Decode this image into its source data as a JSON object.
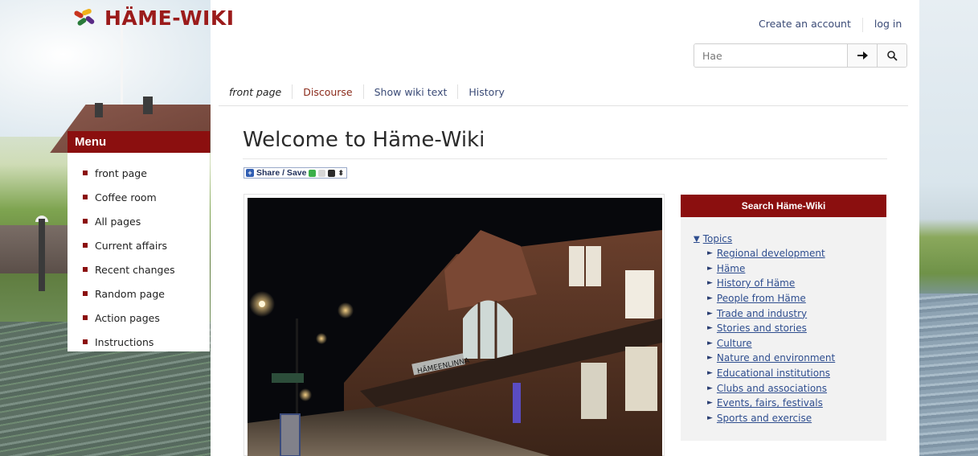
{
  "logo": {
    "text": "HÄME-WIKI"
  },
  "menu": {
    "title": "Menu",
    "items": [
      {
        "label": "front page"
      },
      {
        "label": "Coffee room"
      },
      {
        "label": "All pages"
      },
      {
        "label": "Current affairs"
      },
      {
        "label": "Recent changes"
      },
      {
        "label": "Random page"
      },
      {
        "label": "Action pages"
      },
      {
        "label": "Instructions"
      }
    ]
  },
  "header": {
    "create_account": "Create an account",
    "login": "log in",
    "search": {
      "placeholder": "Hae",
      "go_icon": "arrow-right-icon",
      "search_icon": "search-icon"
    }
  },
  "tabs": [
    {
      "label": "front page"
    },
    {
      "label": "Discourse"
    },
    {
      "label": "Show wiki text"
    },
    {
      "label": "History"
    }
  ],
  "page": {
    "title": "Welcome to Häme-Wiki",
    "share_label": "Share / Save"
  },
  "photo": {
    "sign_text": "HÄMEENLINNA"
  },
  "sidepanel": {
    "title": "Search Häme-Wiki",
    "topics_label": "Topics",
    "topics": [
      "Regional development",
      "Häme",
      "History of Häme",
      "People from Häme",
      "Trade and industry",
      "Stories and stories",
      "Culture",
      "Nature and environment",
      "Educational institutions",
      "Clubs and associations",
      "Events, fairs, festivals",
      "Sports and exercise"
    ]
  },
  "colors": {
    "brand": "#8b0f0f",
    "link": "#2f4e8f"
  }
}
